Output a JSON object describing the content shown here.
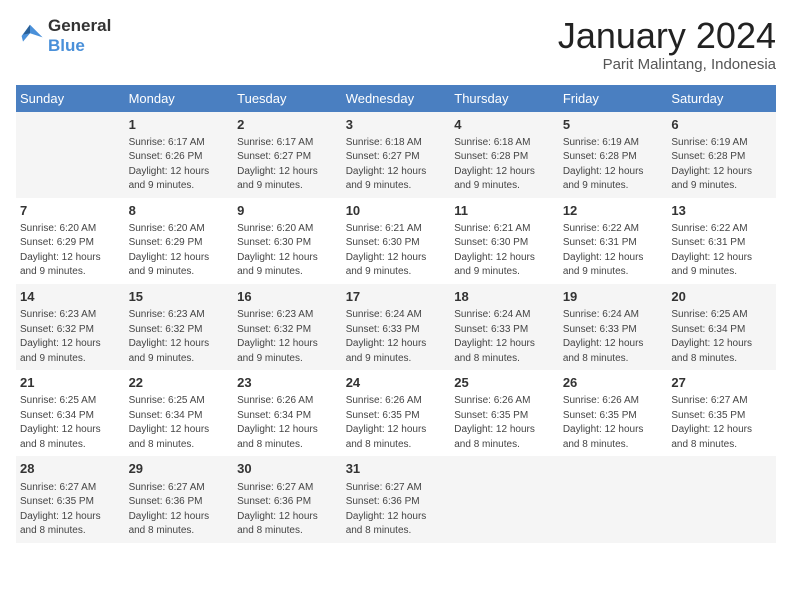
{
  "logo": {
    "line1": "General",
    "line2": "Blue"
  },
  "title": "January 2024",
  "location": "Parit Malintang, Indonesia",
  "weekdays": [
    "Sunday",
    "Monday",
    "Tuesday",
    "Wednesday",
    "Thursday",
    "Friday",
    "Saturday"
  ],
  "weeks": [
    [
      {
        "day": "",
        "info": ""
      },
      {
        "day": "1",
        "info": "Sunrise: 6:17 AM\nSunset: 6:26 PM\nDaylight: 12 hours\nand 9 minutes."
      },
      {
        "day": "2",
        "info": "Sunrise: 6:17 AM\nSunset: 6:27 PM\nDaylight: 12 hours\nand 9 minutes."
      },
      {
        "day": "3",
        "info": "Sunrise: 6:18 AM\nSunset: 6:27 PM\nDaylight: 12 hours\nand 9 minutes."
      },
      {
        "day": "4",
        "info": "Sunrise: 6:18 AM\nSunset: 6:28 PM\nDaylight: 12 hours\nand 9 minutes."
      },
      {
        "day": "5",
        "info": "Sunrise: 6:19 AM\nSunset: 6:28 PM\nDaylight: 12 hours\nand 9 minutes."
      },
      {
        "day": "6",
        "info": "Sunrise: 6:19 AM\nSunset: 6:28 PM\nDaylight: 12 hours\nand 9 minutes."
      }
    ],
    [
      {
        "day": "7",
        "info": "Sunrise: 6:20 AM\nSunset: 6:29 PM\nDaylight: 12 hours\nand 9 minutes."
      },
      {
        "day": "8",
        "info": "Sunrise: 6:20 AM\nSunset: 6:29 PM\nDaylight: 12 hours\nand 9 minutes."
      },
      {
        "day": "9",
        "info": "Sunrise: 6:20 AM\nSunset: 6:30 PM\nDaylight: 12 hours\nand 9 minutes."
      },
      {
        "day": "10",
        "info": "Sunrise: 6:21 AM\nSunset: 6:30 PM\nDaylight: 12 hours\nand 9 minutes."
      },
      {
        "day": "11",
        "info": "Sunrise: 6:21 AM\nSunset: 6:30 PM\nDaylight: 12 hours\nand 9 minutes."
      },
      {
        "day": "12",
        "info": "Sunrise: 6:22 AM\nSunset: 6:31 PM\nDaylight: 12 hours\nand 9 minutes."
      },
      {
        "day": "13",
        "info": "Sunrise: 6:22 AM\nSunset: 6:31 PM\nDaylight: 12 hours\nand 9 minutes."
      }
    ],
    [
      {
        "day": "14",
        "info": "Sunrise: 6:23 AM\nSunset: 6:32 PM\nDaylight: 12 hours\nand 9 minutes."
      },
      {
        "day": "15",
        "info": "Sunrise: 6:23 AM\nSunset: 6:32 PM\nDaylight: 12 hours\nand 9 minutes."
      },
      {
        "day": "16",
        "info": "Sunrise: 6:23 AM\nSunset: 6:32 PM\nDaylight: 12 hours\nand 9 minutes."
      },
      {
        "day": "17",
        "info": "Sunrise: 6:24 AM\nSunset: 6:33 PM\nDaylight: 12 hours\nand 9 minutes."
      },
      {
        "day": "18",
        "info": "Sunrise: 6:24 AM\nSunset: 6:33 PM\nDaylight: 12 hours\nand 8 minutes."
      },
      {
        "day": "19",
        "info": "Sunrise: 6:24 AM\nSunset: 6:33 PM\nDaylight: 12 hours\nand 8 minutes."
      },
      {
        "day": "20",
        "info": "Sunrise: 6:25 AM\nSunset: 6:34 PM\nDaylight: 12 hours\nand 8 minutes."
      }
    ],
    [
      {
        "day": "21",
        "info": "Sunrise: 6:25 AM\nSunset: 6:34 PM\nDaylight: 12 hours\nand 8 minutes."
      },
      {
        "day": "22",
        "info": "Sunrise: 6:25 AM\nSunset: 6:34 PM\nDaylight: 12 hours\nand 8 minutes."
      },
      {
        "day": "23",
        "info": "Sunrise: 6:26 AM\nSunset: 6:34 PM\nDaylight: 12 hours\nand 8 minutes."
      },
      {
        "day": "24",
        "info": "Sunrise: 6:26 AM\nSunset: 6:35 PM\nDaylight: 12 hours\nand 8 minutes."
      },
      {
        "day": "25",
        "info": "Sunrise: 6:26 AM\nSunset: 6:35 PM\nDaylight: 12 hours\nand 8 minutes."
      },
      {
        "day": "26",
        "info": "Sunrise: 6:26 AM\nSunset: 6:35 PM\nDaylight: 12 hours\nand 8 minutes."
      },
      {
        "day": "27",
        "info": "Sunrise: 6:27 AM\nSunset: 6:35 PM\nDaylight: 12 hours\nand 8 minutes."
      }
    ],
    [
      {
        "day": "28",
        "info": "Sunrise: 6:27 AM\nSunset: 6:35 PM\nDaylight: 12 hours\nand 8 minutes."
      },
      {
        "day": "29",
        "info": "Sunrise: 6:27 AM\nSunset: 6:36 PM\nDaylight: 12 hours\nand 8 minutes."
      },
      {
        "day": "30",
        "info": "Sunrise: 6:27 AM\nSunset: 6:36 PM\nDaylight: 12 hours\nand 8 minutes."
      },
      {
        "day": "31",
        "info": "Sunrise: 6:27 AM\nSunset: 6:36 PM\nDaylight: 12 hours\nand 8 minutes."
      },
      {
        "day": "",
        "info": ""
      },
      {
        "day": "",
        "info": ""
      },
      {
        "day": "",
        "info": ""
      }
    ]
  ]
}
